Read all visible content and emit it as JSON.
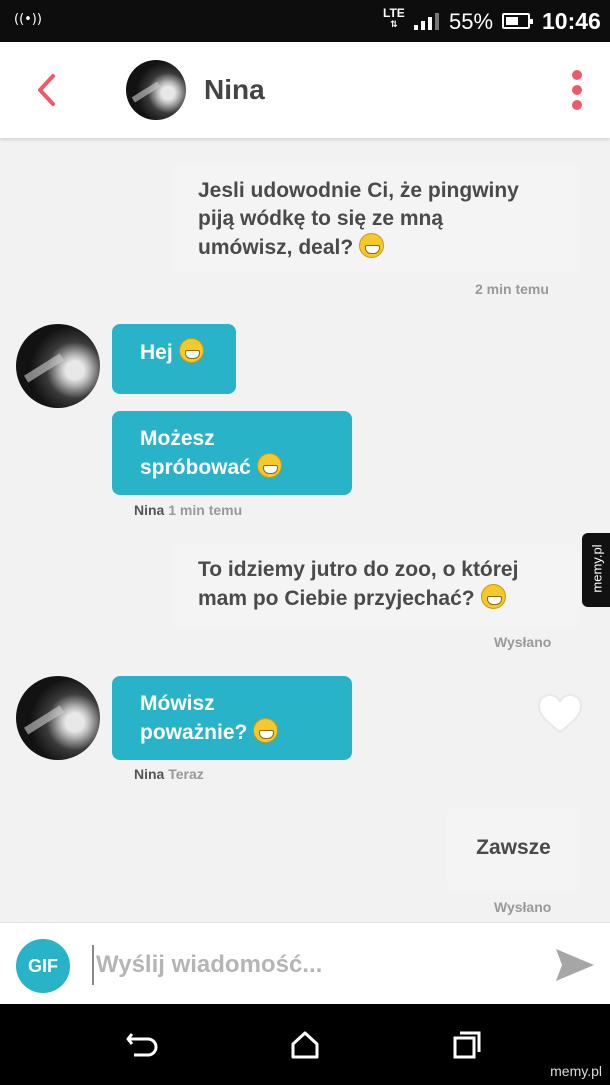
{
  "status_bar": {
    "network": "LTE",
    "battery_percent": "55%",
    "time": "10:46"
  },
  "header": {
    "contact_name": "Nina"
  },
  "messages": [
    {
      "direction": "outgoing",
      "text": "Jesli udowodnie Ci, że pingwiny\npiją wódkę to się ze mną\numówisz, deal?",
      "emoji": "grimacing-emoji",
      "meta": "2 min temu"
    },
    {
      "direction": "incoming",
      "text": "Hej",
      "emoji": "grinning-emoji"
    },
    {
      "direction": "incoming",
      "text": "Możesz\nspróbować",
      "emoji": "grinning-emoji",
      "sender": "Nina",
      "meta": "1 min temu"
    },
    {
      "direction": "outgoing",
      "text": "To idziemy jutro do zoo, o której\nmam po Ciebie przyjechać?",
      "emoji": "grimacing-emoji",
      "meta": "Wysłano"
    },
    {
      "direction": "incoming",
      "text": "Mówisz\npoważnie?",
      "emoji": "grinning-emoji",
      "sender": "Nina",
      "meta": "Teraz"
    },
    {
      "direction": "outgoing",
      "text": "Zawsze",
      "meta": "Wysłano"
    }
  ],
  "composer": {
    "gif_label": "GIF",
    "placeholder": "Wyślij wiadomość..."
  },
  "watermark": {
    "side": "memy.pl",
    "corner": "memy.pl"
  },
  "colors": {
    "accent_red": "#ef5a6a",
    "incoming_bubble": "#28b3c8",
    "outgoing_bubble": "#f4f4f4"
  }
}
